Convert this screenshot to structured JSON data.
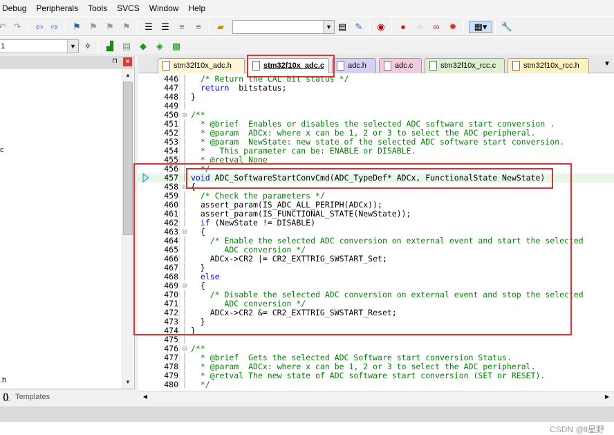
{
  "menu": [
    "Debug",
    "Peripherals",
    "Tools",
    "SVCS",
    "Window",
    "Help"
  ],
  "toolbar2": {
    "target_combo": "1"
  },
  "left_pane": {
    "fragments": [
      "c",
      ".h"
    ],
    "tabs": [
      "{}̲",
      "Templates"
    ]
  },
  "tabs": [
    {
      "label": "stm32f10x_adc.h",
      "bg": "#fff6d6"
    },
    {
      "label": "stm32f10x_adc.c",
      "bg": "#ffffff",
      "active": true
    },
    {
      "label": "adc.h",
      "bg": "#d8d0f4"
    },
    {
      "label": "adc.c",
      "bg": "#f3c9de"
    },
    {
      "label": "stm32f10x_rcc.c",
      "bg": "#dff0d2"
    },
    {
      "label": "stm32f10x_rcc.h",
      "bg": "#fff0bf"
    }
  ],
  "code_lines": [
    {
      "n": "446",
      "fold": "",
      "segs": [
        [
          "c",
          "  /* Return the CAL bit status */"
        ]
      ]
    },
    {
      "n": "447",
      "fold": "",
      "segs": [
        [
          "k",
          "  return"
        ],
        [
          "",
          "  bitstatus;"
        ]
      ]
    },
    {
      "n": "448",
      "fold": "",
      "segs": [
        [
          "",
          "}"
        ]
      ]
    },
    {
      "n": "449",
      "fold": "",
      "segs": [
        [
          "",
          ""
        ]
      ]
    },
    {
      "n": "450",
      "fold": "⊟",
      "segs": [
        [
          "c",
          "/**"
        ]
      ]
    },
    {
      "n": "451",
      "fold": "",
      "segs": [
        [
          "c",
          "  * @brief  Enables or disables the selected ADC software start conversion ."
        ]
      ]
    },
    {
      "n": "452",
      "fold": "",
      "segs": [
        [
          "c",
          "  * @param  ADCx: where x can be 1, 2 or 3 to select the ADC peripheral."
        ]
      ]
    },
    {
      "n": "453",
      "fold": "",
      "segs": [
        [
          "c",
          "  * @param  NewState: new state of the selected ADC software start conversion."
        ]
      ]
    },
    {
      "n": "454",
      "fold": "",
      "segs": [
        [
          "c",
          "  *   This parameter can be: ENABLE or DISABLE."
        ]
      ]
    },
    {
      "n": "455",
      "fold": "",
      "segs": [
        [
          "c",
          "  * @retval None"
        ]
      ]
    },
    {
      "n": "456",
      "fold": "",
      "segs": [
        [
          "c",
          "  */"
        ]
      ]
    },
    {
      "n": "457",
      "fold": "",
      "hl": true,
      "segs": [
        [
          "k",
          "void"
        ],
        [
          "",
          " ADC_SoftwareStartConvCmd(ADC_TypeDef* ADCx, FunctionalState NewState)"
        ]
      ]
    },
    {
      "n": "458",
      "fold": "⊟",
      "segs": [
        [
          "",
          "{"
        ]
      ]
    },
    {
      "n": "459",
      "fold": "",
      "segs": [
        [
          "c",
          "  /* Check the parameters */"
        ]
      ]
    },
    {
      "n": "460",
      "fold": "",
      "segs": [
        [
          "",
          "  assert_param(IS_ADC_ALL_PERIPH(ADCx));"
        ]
      ]
    },
    {
      "n": "461",
      "fold": "",
      "segs": [
        [
          "",
          "  assert_param(IS_FUNCTIONAL_STATE(NewState));"
        ]
      ]
    },
    {
      "n": "462",
      "fold": "",
      "segs": [
        [
          "k",
          "  if"
        ],
        [
          "",
          " (NewState != DISABLE)"
        ]
      ]
    },
    {
      "n": "463",
      "fold": "⊟",
      "segs": [
        [
          "",
          "  {"
        ]
      ]
    },
    {
      "n": "464",
      "fold": "",
      "segs": [
        [
          "c",
          "    /* Enable the selected ADC conversion on external event and start the selected"
        ]
      ]
    },
    {
      "n": "465",
      "fold": "",
      "segs": [
        [
          "c",
          "       ADC conversion */"
        ]
      ]
    },
    {
      "n": "466",
      "fold": "",
      "segs": [
        [
          "",
          "    ADCx->CR2 |= CR2_EXTTRIG_SWSTART_Set;"
        ]
      ]
    },
    {
      "n": "467",
      "fold": "",
      "segs": [
        [
          "",
          "  }"
        ]
      ]
    },
    {
      "n": "468",
      "fold": "",
      "segs": [
        [
          "k",
          "  else"
        ]
      ]
    },
    {
      "n": "469",
      "fold": "⊟",
      "segs": [
        [
          "",
          "  {"
        ]
      ]
    },
    {
      "n": "470",
      "fold": "",
      "segs": [
        [
          "c",
          "    /* Disable the selected ADC conversion on external event and stop the selected"
        ]
      ]
    },
    {
      "n": "471",
      "fold": "",
      "segs": [
        [
          "c",
          "       ADC conversion */"
        ]
      ]
    },
    {
      "n": "472",
      "fold": "",
      "segs": [
        [
          "",
          "    ADCx->CR2 &= CR2_EXTTRIG_SWSTART_Reset;"
        ]
      ]
    },
    {
      "n": "473",
      "fold": "",
      "segs": [
        [
          "",
          "  }"
        ]
      ]
    },
    {
      "n": "474",
      "fold": "",
      "segs": [
        [
          "",
          "}"
        ]
      ]
    },
    {
      "n": "475",
      "fold": "",
      "segs": [
        [
          "",
          ""
        ]
      ]
    },
    {
      "n": "476",
      "fold": "⊟",
      "segs": [
        [
          "c",
          "/**"
        ]
      ]
    },
    {
      "n": "477",
      "fold": "",
      "segs": [
        [
          "c",
          "  * @brief  Gets the selected ADC Software start conversion Status."
        ]
      ]
    },
    {
      "n": "478",
      "fold": "",
      "segs": [
        [
          "c",
          "  * @param  ADCx: where x can be 1, 2 or 3 to select the ADC peripheral."
        ]
      ]
    },
    {
      "n": "479",
      "fold": "",
      "segs": [
        [
          "c",
          "  * @retval The new state of ADC software start conversion (SET or RESET)."
        ]
      ]
    },
    {
      "n": "480",
      "fold": "",
      "segs": [
        [
          "c",
          "  */"
        ]
      ]
    }
  ],
  "watermark": "CSDN @ll星野",
  "colors": {
    "annotation": "#e03030",
    "comment": "#008000",
    "keyword": "#0000ff"
  }
}
